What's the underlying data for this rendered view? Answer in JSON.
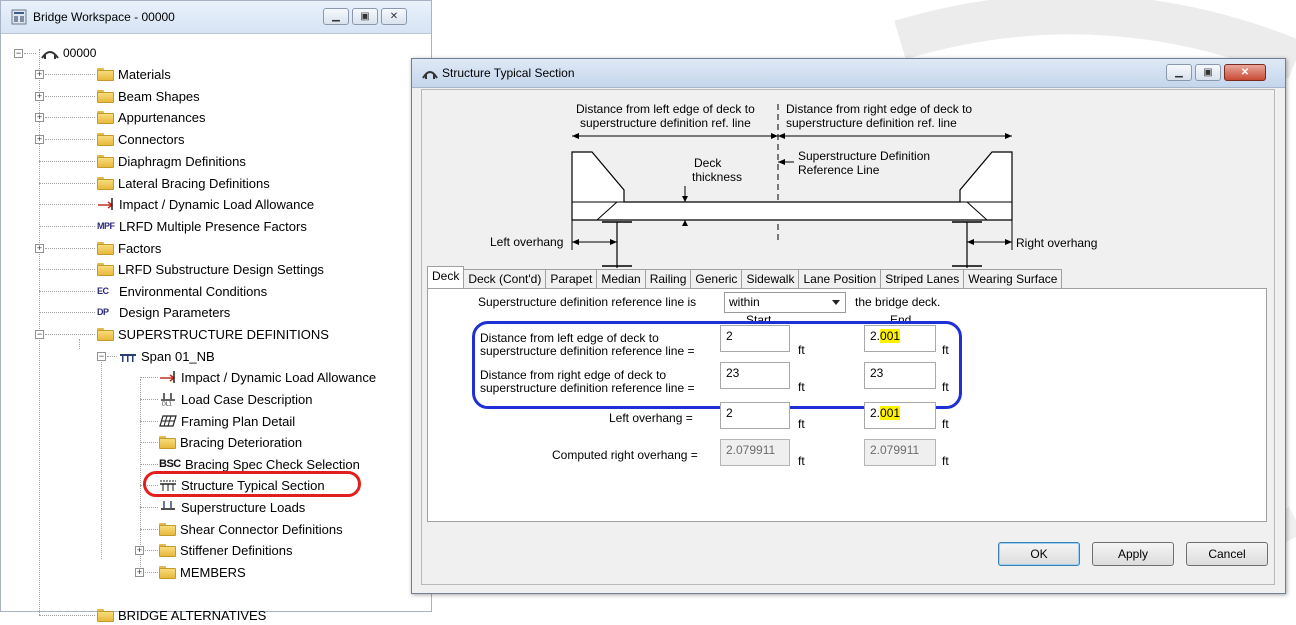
{
  "workspace": {
    "title": "Bridge Workspace - 00000",
    "tree": [
      {
        "label": "00000",
        "icon": "bridge-icon"
      },
      {
        "label": "Materials",
        "icon": "folder-icon"
      },
      {
        "label": "Beam Shapes",
        "icon": "folder-icon"
      },
      {
        "label": "Appurtenances",
        "icon": "folder-icon"
      },
      {
        "label": "Connectors",
        "icon": "folder-icon"
      },
      {
        "label": "Diaphragm Definitions",
        "icon": "folder-icon"
      },
      {
        "label": "Lateral Bracing Definitions",
        "icon": "folder-icon"
      },
      {
        "label": "Impact / Dynamic Load Allowance",
        "icon": "impact-icon"
      },
      {
        "label": "LRFD Multiple Presence Factors",
        "icon": "mpf-icon",
        "badge": "MPF"
      },
      {
        "label": "Factors",
        "icon": "folder-icon"
      },
      {
        "label": "LRFD Substructure Design Settings",
        "icon": "folder-icon"
      },
      {
        "label": "Environmental Conditions",
        "icon": "ec-icon",
        "badge": "EC"
      },
      {
        "label": "Design Parameters",
        "icon": "dp-icon",
        "badge": "DP"
      },
      {
        "label": "SUPERSTRUCTURE DEFINITIONS",
        "icon": "folder-icon"
      },
      {
        "label": "Span 01_NB",
        "icon": "span-icon"
      },
      {
        "label": "Impact / Dynamic Load Allowance",
        "icon": "impact-icon"
      },
      {
        "label": "Load Case Description",
        "icon": "load-case-icon"
      },
      {
        "label": "Framing Plan Detail",
        "icon": "framing-plan-icon"
      },
      {
        "label": "Bracing Deterioration",
        "icon": "folder-icon"
      },
      {
        "label": "Bracing Spec Check Selection",
        "icon": "bsc-icon",
        "badge": "BSC"
      },
      {
        "label": "Structure Typical Section",
        "icon": "typical-section-icon"
      },
      {
        "label": "Superstructure Loads",
        "icon": "superstructure-loads-icon"
      },
      {
        "label": "Shear Connector Definitions",
        "icon": "folder-icon"
      },
      {
        "label": "Stiffener Definitions",
        "icon": "folder-icon"
      },
      {
        "label": "MEMBERS",
        "icon": "folder-icon"
      },
      {
        "label": "BRIDGE ALTERNATIVES",
        "icon": "folder-icon"
      }
    ]
  },
  "dialog": {
    "title": "Structure Typical Section",
    "diagram": {
      "dist_left_line1": "Distance from left edge of deck to",
      "dist_left_line2": "superstructure definition ref. line",
      "dist_right_line1": "Distance from right edge of deck to",
      "dist_right_line2": "superstructure definition ref. line",
      "deck_line1": "Deck",
      "deck_line2": "thickness",
      "ref_line1": "Superstructure Definition",
      "ref_line2": "Reference Line",
      "left_overhang": "Left overhang",
      "right_overhang": "Right overhang"
    },
    "tabs": [
      "Deck",
      "Deck (Cont'd)",
      "Parapet",
      "Median",
      "Railing",
      "Generic",
      "Sidewalk",
      "Lane Position",
      "Striped Lanes",
      "Wearing Surface"
    ],
    "active_tab": "Deck",
    "ref_line_prefix": "Superstructure definition reference line is",
    "ref_line_value": "within",
    "ref_line_suffix": "the bridge deck.",
    "col_start": "Start",
    "col_end": "End",
    "left_dist_line1": "Distance from left edge of deck to",
    "left_dist_line2": "superstructure definition reference line =",
    "right_dist_line1": "Distance from right edge of deck to",
    "right_dist_line2": "superstructure definition reference line =",
    "left_overhang_label": "Left overhang =",
    "computed_right_label": "Computed right overhang =",
    "unit": "ft",
    "left_dist_start": "2",
    "left_dist_end_a": "2.",
    "left_dist_end_b": "001",
    "right_dist_start": "23",
    "right_dist_end": "23",
    "left_overhang_start": "2",
    "left_overhang_end_a": "2.",
    "left_overhang_end_b": "001",
    "computed_right_start": "2.079911",
    "computed_right_end": "2.079911",
    "ok": "OK",
    "apply": "Apply",
    "cancel": "Cancel"
  }
}
